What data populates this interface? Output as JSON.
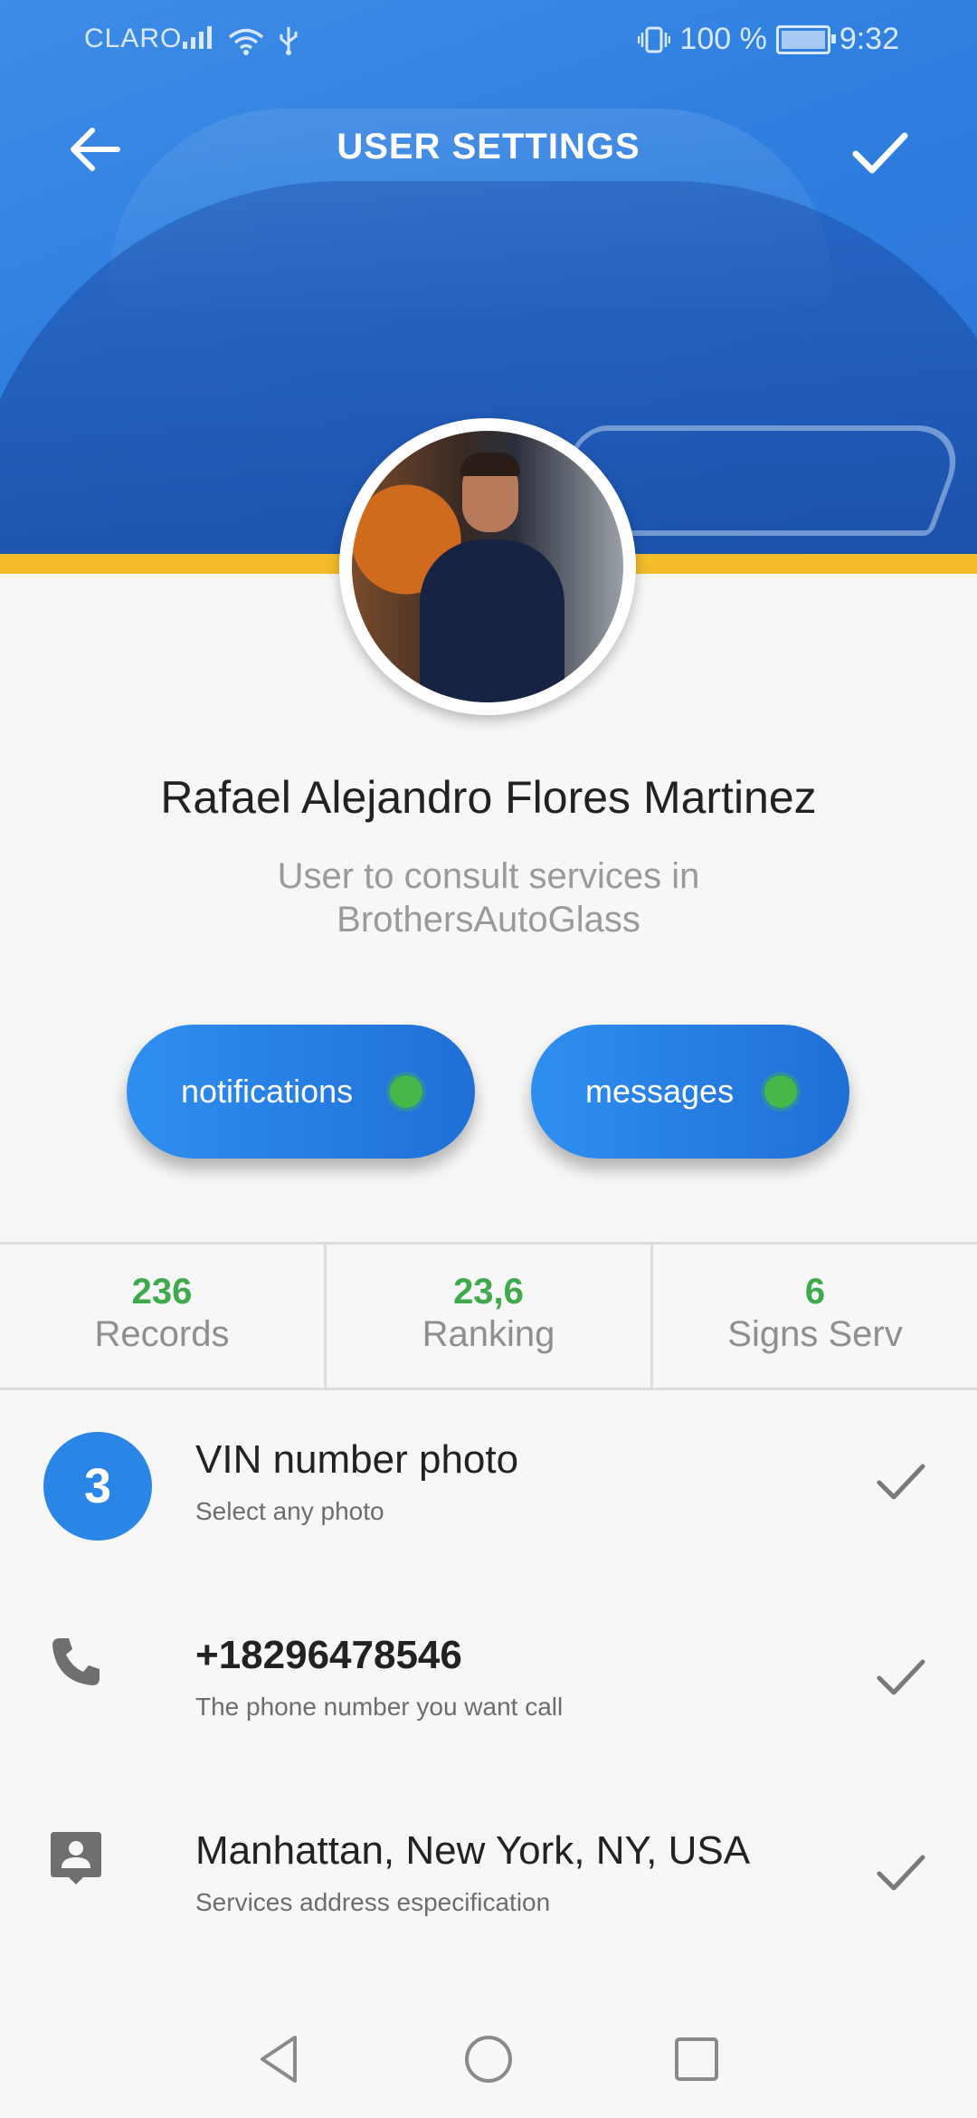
{
  "status_bar": {
    "carrier": "CLARO",
    "battery_text": "100 %",
    "time": "9:32"
  },
  "app_bar": {
    "title": "USER SETTINGS",
    "back_icon": "arrow-back-icon",
    "confirm_icon": "check-icon"
  },
  "profile": {
    "name": "Rafael Alejandro Flores Martinez",
    "description": "User to consult services in BrothersAutoGlass"
  },
  "toggles": [
    {
      "label": "notifications",
      "enabled": true
    },
    {
      "label": "messages",
      "enabled": true
    }
  ],
  "stats": [
    {
      "value": "236",
      "label": "Records"
    },
    {
      "value": "23,6",
      "label": "Ranking"
    },
    {
      "value": "6",
      "label": "Signs Serv"
    }
  ],
  "settings": [
    {
      "badge": "3",
      "title": "VIN number photo",
      "subtitle": "Select any photo",
      "icon": "number-badge"
    },
    {
      "title": "+18296478546",
      "subtitle": "The phone number you want call",
      "icon": "phone-icon"
    },
    {
      "title": "Manhattan, New York, NY, USA",
      "subtitle": "Services address especification",
      "icon": "contact-location-icon"
    }
  ],
  "colors": {
    "header_blue": "#2f7fe0",
    "accent_gold": "#f4bb2a",
    "stat_green": "#3faa4c",
    "toggle_dot_green": "#46b84a"
  }
}
